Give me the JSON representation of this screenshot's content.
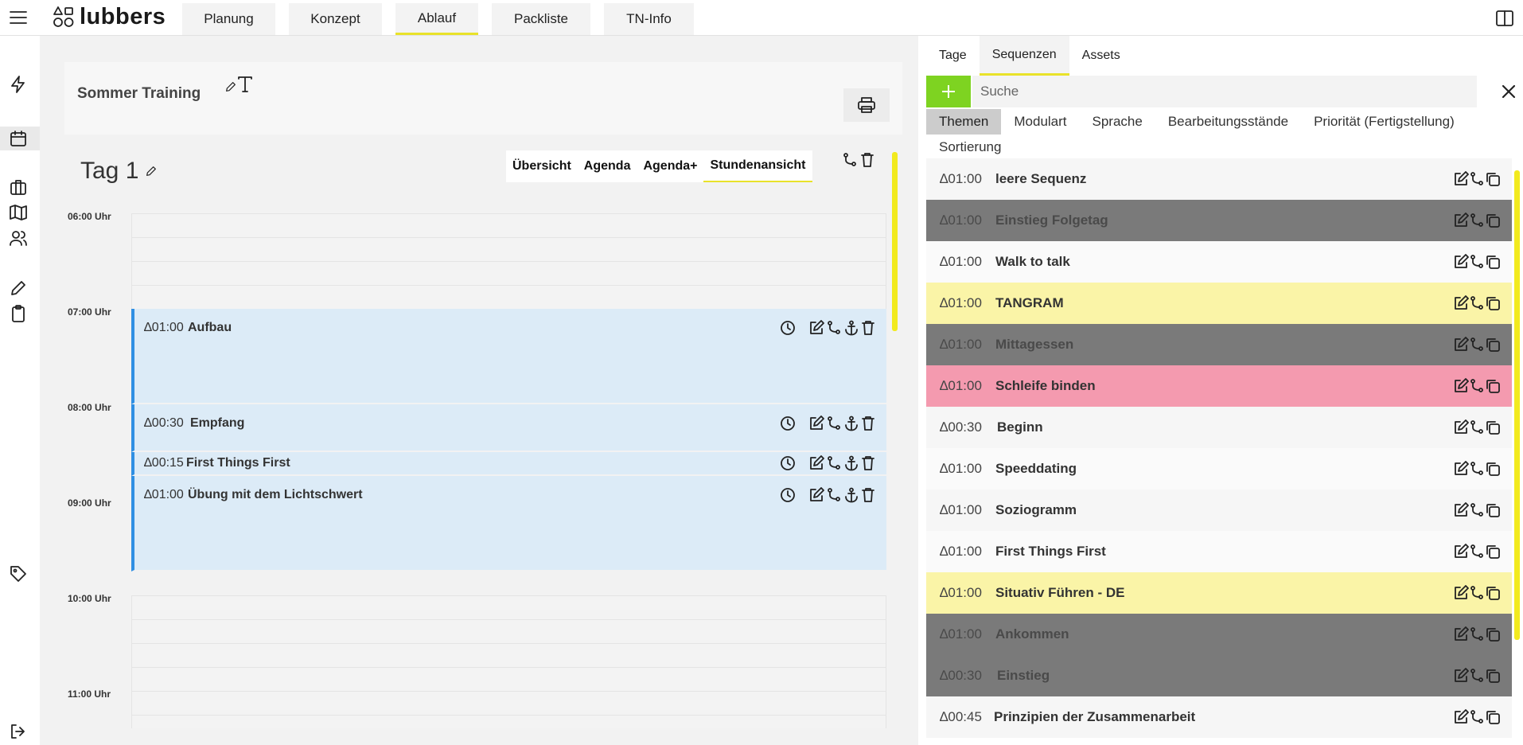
{
  "brand": {
    "name": "lubbers"
  },
  "nav": {
    "tabs": [
      {
        "label": "Planung"
      },
      {
        "label": "Konzept"
      },
      {
        "label": "Ablauf",
        "active": true
      },
      {
        "label": "Packliste"
      },
      {
        "label": "TN-Info"
      }
    ]
  },
  "rail_icons": [
    "lightning-icon",
    "calendar-icon",
    "briefcase-icon",
    "map-icon",
    "users-icon",
    "pencil-icon",
    "clipboard-icon",
    "tag-icon",
    "logout-icon"
  ],
  "training": {
    "title": "Sommer Training"
  },
  "day": {
    "title": "Tag 1",
    "views": [
      {
        "label": "Übersicht"
      },
      {
        "label": "Agenda"
      },
      {
        "label": "Agenda+"
      },
      {
        "label": "Stundenansicht",
        "active": true
      }
    ],
    "hours": [
      "06:00 Uhr",
      "07:00 Uhr",
      "08:00 Uhr",
      "09:00 Uhr",
      "10:00 Uhr",
      "11:00 Uhr"
    ],
    "events": [
      {
        "duration": "∆01:00",
        "name": "Aufbau"
      },
      {
        "duration": "∆00:30",
        "name": "Empfang"
      },
      {
        "duration": "∆00:15",
        "name": "First Things First"
      },
      {
        "duration": "∆01:00",
        "name": "Übung mit dem Lichtschwert"
      }
    ]
  },
  "panel": {
    "tabs": [
      {
        "label": "Tage"
      },
      {
        "label": "Sequenzen",
        "active": true
      },
      {
        "label": "Assets"
      }
    ],
    "search": {
      "placeholder": "Suche",
      "value": ""
    },
    "filters": [
      {
        "label": "Themen",
        "active": true
      },
      {
        "label": "Modulart"
      },
      {
        "label": "Sprache"
      },
      {
        "label": "Bearbeitungsstände"
      },
      {
        "label": "Priorität (Fertigstellung)"
      },
      {
        "label": "Sortierung"
      }
    ],
    "sequences": [
      {
        "duration": "∆01:00",
        "name": "leere Sequenz",
        "color": "light"
      },
      {
        "duration": "∆01:00",
        "name": "Einstieg Folgetag",
        "color": "gray"
      },
      {
        "duration": "∆01:00",
        "name": "Walk to talk",
        "color": "white"
      },
      {
        "duration": "∆01:00",
        "name": "TANGRAM",
        "color": "yellow"
      },
      {
        "duration": "∆01:00",
        "name": "Mittagessen",
        "color": "gray"
      },
      {
        "duration": "∆01:00",
        "name": "Schleife binden",
        "color": "pink"
      },
      {
        "duration": "∆00:30",
        "name": "Beginn",
        "color": "light"
      },
      {
        "duration": "∆01:00",
        "name": "Speeddating",
        "color": "white"
      },
      {
        "duration": "∆01:00",
        "name": "Soziogramm",
        "color": "light"
      },
      {
        "duration": "∆01:00",
        "name": "First Things First",
        "color": "white"
      },
      {
        "duration": "∆01:00",
        "name": "Situativ Führen - DE",
        "color": "yellow"
      },
      {
        "duration": "∆01:00",
        "name": "Ankommen",
        "color": "gray"
      },
      {
        "duration": "∆00:30",
        "name": "Einstieg",
        "color": "gray"
      },
      {
        "duration": "∆00:45",
        "name": "Prinzipien der Zusammenarbeit",
        "color": "light"
      }
    ]
  },
  "colors": {
    "accent_yellow": "#e9e22a",
    "add_green": "#7ed321",
    "event_blue": "#dcebf7",
    "event_border": "#2f8fe3",
    "seq_gray": "#7a7a7a",
    "seq_yellow": "#faf4a7",
    "seq_pink": "#f49aaf"
  }
}
